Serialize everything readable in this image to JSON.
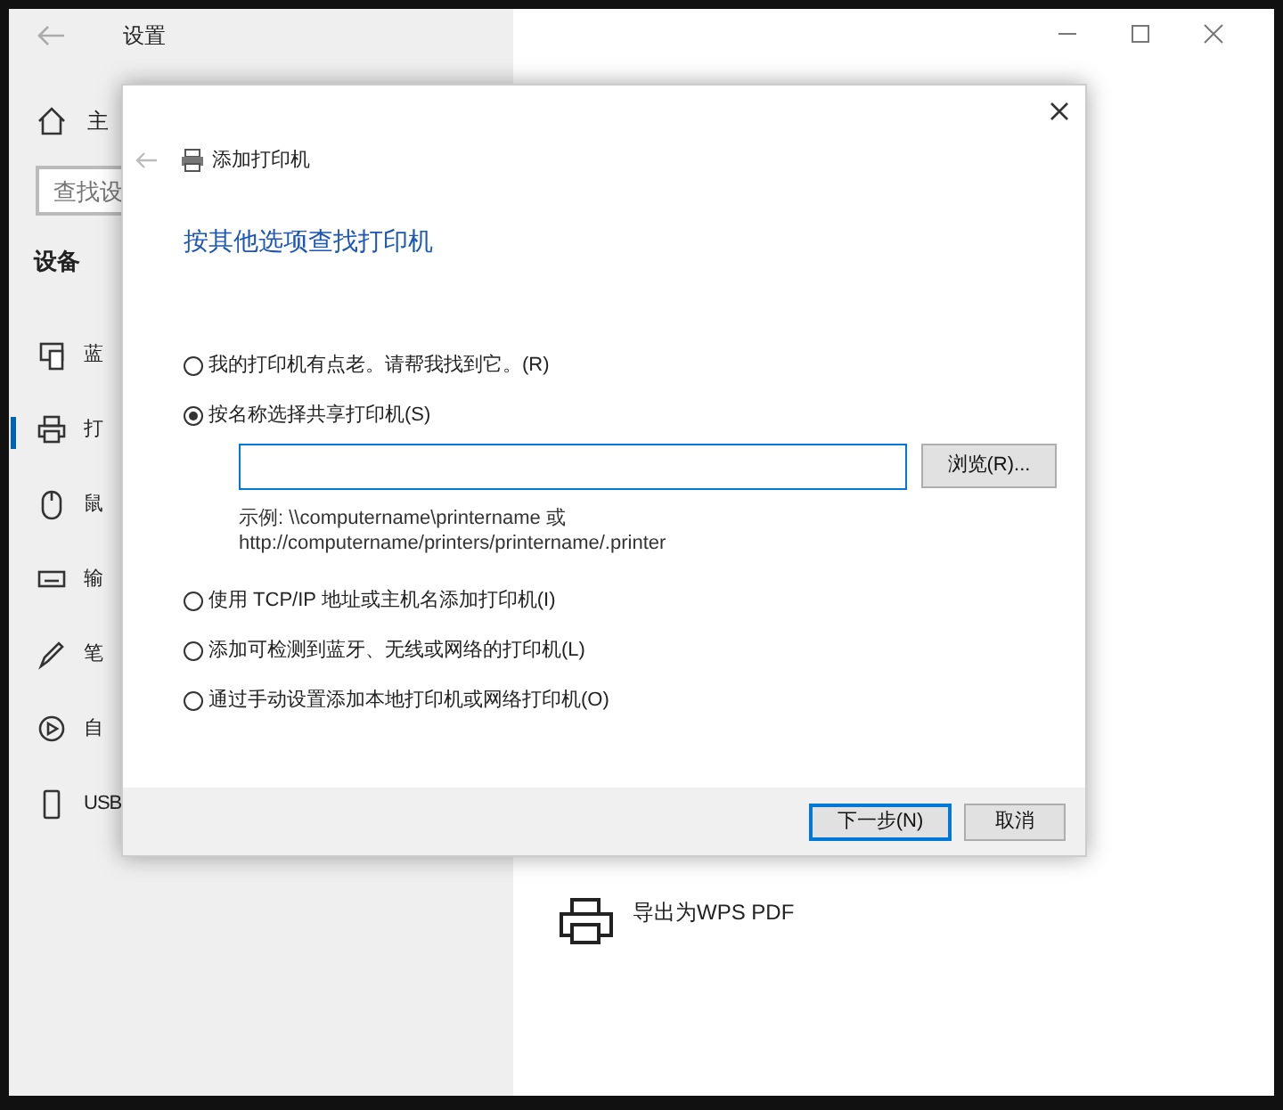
{
  "window": {
    "title": "设置"
  },
  "sidebar": {
    "home": "主",
    "search": {
      "placeholder": "查找设"
    },
    "section": "设备",
    "items": [
      {
        "label": "蓝",
        "kind": "bluetooth",
        "selected": false
      },
      {
        "label": "打",
        "kind": "printer",
        "selected": true
      },
      {
        "label": "鼠",
        "kind": "mouse",
        "selected": false
      },
      {
        "label": "输",
        "kind": "keyboard",
        "selected": false
      },
      {
        "label": "笔",
        "kind": "pen",
        "selected": false
      },
      {
        "label": "自",
        "kind": "autoplay",
        "selected": false
      },
      {
        "label": "USB",
        "kind": "usb",
        "selected": false
      }
    ]
  },
  "printers": [
    {
      "label": "导出为WPS PDF"
    }
  ],
  "dialog": {
    "title": "添加打印机",
    "heading": "按其他选项查找打印机",
    "options": [
      {
        "label": "我的打印机有点老。请帮我找到它。(R)",
        "selected": false
      },
      {
        "label": "按名称选择共享打印机(S)",
        "selected": true
      },
      {
        "label": "使用 TCP/IP 地址或主机名添加打印机(I)",
        "selected": false
      },
      {
        "label": "添加可检测到蓝牙、无线或网络的打印机(L)",
        "selected": false
      },
      {
        "label": "通过手动设置添加本地打印机或网络打印机(O)",
        "selected": false
      }
    ],
    "browse_button": "浏览(R)...",
    "example": [
      "示例: \\\\computername\\printername 或",
      "http://computername/printers/printername/.printer"
    ],
    "buttons": [
      {
        "label": "下一步(N)",
        "default": true
      },
      {
        "label": "取消",
        "default": false
      }
    ]
  }
}
